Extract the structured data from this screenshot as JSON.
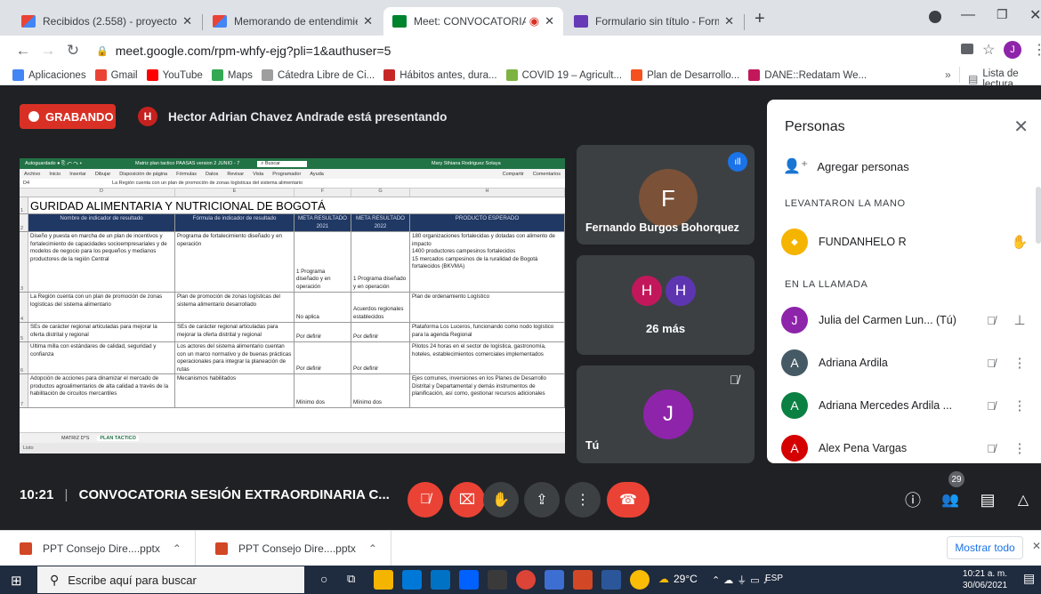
{
  "browser": {
    "tabs": [
      {
        "label": "Recibidos (2.558) - proyectosjulu",
        "icon": "gmail-icon",
        "active": false
      },
      {
        "label": "Memorando de entendimiento-C",
        "icon": "gmail-icon",
        "active": false
      },
      {
        "label": "Meet: CONVOCATORIA SESIC",
        "icon": "meet-icon",
        "active": true
      },
      {
        "label": "Formulario sin título - Formulari",
        "icon": "forms-icon",
        "active": false
      }
    ],
    "new_tab": "+",
    "url": "meet.google.com/rpm-whfy-ejg?pli=1&authuser=5",
    "profile_initial": "J",
    "bookmarks": [
      {
        "label": "Aplicaciones",
        "color": "#4285f4"
      },
      {
        "label": "Gmail",
        "color": "#ea4335"
      },
      {
        "label": "YouTube",
        "color": "#ff0000"
      },
      {
        "label": "Maps",
        "color": "#34a853"
      },
      {
        "label": "Cátedra Libre de Ci...",
        "color": "#9e9e9e"
      },
      {
        "label": "Hábitos antes, dura...",
        "color": "#c62828"
      },
      {
        "label": "COVID 19 – Agricult...",
        "color": "#7cb342"
      },
      {
        "label": "Plan de Desarrollo...",
        "color": "#f4511e"
      },
      {
        "label": "DANE::Redatam We...",
        "color": "#c2185b"
      }
    ],
    "reading_list": "Lista de lectura"
  },
  "meet": {
    "recording_label": "GRABANDO",
    "presenter_initial": "H",
    "presenter_text": "Hector Adrian Chavez Andrade está presentando",
    "meeting_time": "10:21",
    "meeting_title": "CONVOCATORIA SESIÓN EXTRAORDINARIA C...",
    "participant_count_badge": "29",
    "tiles": [
      {
        "initial": "F",
        "name": "Fernando Burgos Bohorquez",
        "color": "#7b5137"
      },
      {
        "initials": [
          "H",
          "H"
        ],
        "more": "26 más",
        "colors": [
          "#c2185b",
          "#5e35b1"
        ]
      },
      {
        "initial": "J",
        "name": "Tú",
        "color": "#8e24aa"
      }
    ]
  },
  "spreadsheet": {
    "window_title": "Matriz plan tactico PAASAS version 2 JUNIO - 7",
    "search": "Buscar",
    "user": "Mary Sthiana Rodriguez Sotaya",
    "menu": [
      "Archivo",
      "Inicio",
      "Insertar",
      "Dibujar",
      "Disposición de página",
      "Fórmulas",
      "Datos",
      "Revisar",
      "Vista",
      "Programador",
      "Ayuda"
    ],
    "share": "Compartir",
    "comments": "Comentarios",
    "cell_ref": "D4",
    "formula": "La Región cuenta con un plan de promoción de zonas logísticas del sistema alimentario",
    "columns": [
      "D",
      "E",
      "F",
      "G",
      "H"
    ],
    "title_row": "GURIDAD ALIMENTARIA Y NUTRICIONAL DE BOGOTÁ",
    "headers": [
      "Nombre de indicador de resultado",
      "Fórmula de indicador de resultado",
      "META RESULTADO 2021",
      "META RESULTADO 2022",
      "PRODUCTO ESPERADO"
    ],
    "rows": [
      {
        "n": "3",
        "cells": [
          "Diseño y puesta en marcha de un plan de incentivos y fortalecimiento de capacidades socioempresariales y de modelos de negocio para los pequeños y medianos productores de la región Central",
          "Programa de fortalecimiento diseñado y en operación",
          "1 Programa diseñado y en operación",
          "1 Programa diseñado y en operación",
          "180 organizaciones fortalecidas y dotadas con alimento de impacto\n1400 productores campesinos fortalecidos\n15 mercados campesinos de la ruralidad de Bogotá fortalecidos (BKVMA)"
        ]
      },
      {
        "n": "4",
        "cells": [
          "La Región cuenta con un plan de promoción de zonas logísticas del sistema alimentario",
          "Plan de promoción de zonas logísticas del sistema alimentario desarrollado",
          "No aplica",
          "Acuerdos regionales establecidos",
          "Plan de ordenamiento Logístico"
        ]
      },
      {
        "n": "5",
        "cells": [
          "SEs de carácter regional articuladas para mejorar la oferta distrital y regional",
          "SEs de carácter regional articuladas para mejorar la oferta distrital y regional",
          "Por definir",
          "Por definir",
          "Plataforma Los Luceros, funcionando como nodo logístico para la agenda Regional"
        ]
      },
      {
        "n": "6",
        "cells": [
          "Ultima milla con estándares de calidad, seguridad y confianza",
          "Los actores del sistema alimentario cuentan con un marco normativo y de buenas prácticas operacionales para integrar la planeación de rutas",
          "Por definir",
          "Por definir",
          "Pilotos 24 horas en el sector de logística, gastronomía, hoteles, establecimientos comerciales implementados"
        ]
      },
      {
        "n": "7",
        "cells": [
          "Adopción de acciones para dinamizar el mercado de productos agroalimentarios de alta calidad a través de la habilitación de circuitos mercantiles",
          "Mecanismos habilitados",
          "Mínimo dos",
          "Mínimo dos",
          "Ejes comunes, inversiones en los Planes de Desarrollo Distrital y Departamental y demás instrumentos de planificación, así como, gestionar recursos adicionales"
        ]
      }
    ],
    "sheet_tabs": [
      "MATRIZ D*S",
      "PLAN TACTICO"
    ],
    "status": "Listo"
  },
  "people_panel": {
    "title": "Personas",
    "add_people": "Agregar personas",
    "raised_hands_title": "LEVANTARON LA MANO",
    "raised": [
      {
        "name": "FUNDANHELO R",
        "avatar_color": "#f5b400"
      }
    ],
    "in_call_title": "EN LA LLAMADA",
    "in_call": [
      {
        "initial": "J",
        "name": "Julia del Carmen Lun... (Tú)",
        "color": "#8e24aa"
      },
      {
        "initial": "A",
        "name": "Adriana Ardila",
        "color": "#455a64"
      },
      {
        "initial": "A",
        "name": "Adriana Mercedes Ardila ...",
        "color": "#0b8043"
      },
      {
        "initial": "A",
        "name": "Alex Pena Vargas",
        "color": "#d50000"
      }
    ]
  },
  "downloads": {
    "items": [
      "PPT Consejo Dire....pptx",
      "PPT Consejo Dire....pptx"
    ],
    "show_all": "Mostrar todo"
  },
  "taskbar": {
    "search_placeholder": "Escribe aquí para buscar",
    "weather": "29°C",
    "lang": "ESP",
    "time": "10:21 a. m.",
    "date": "30/06/2021"
  }
}
